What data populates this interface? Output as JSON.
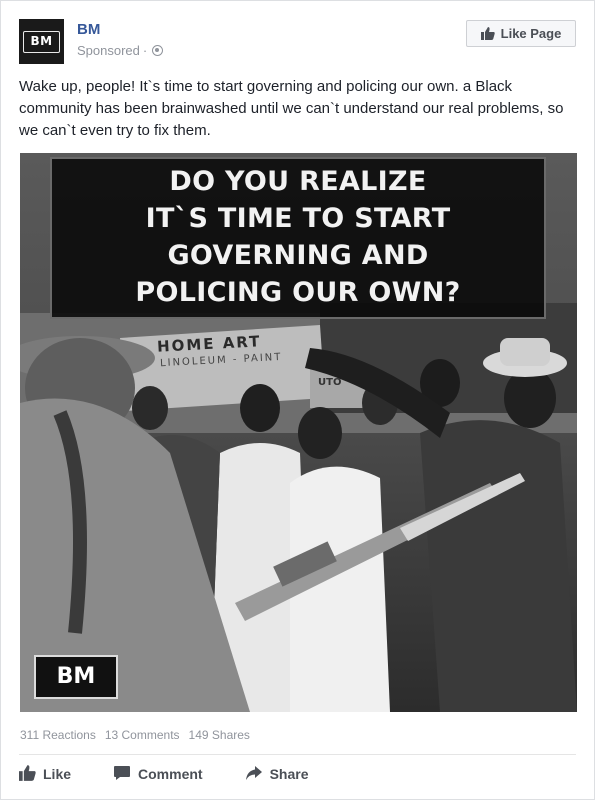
{
  "header": {
    "avatar_text": "BM",
    "page_name": "BM",
    "sponsored_label": "Sponsored",
    "separator": "·",
    "like_page_label": "Like Page"
  },
  "post": {
    "text": "Wake up, people! It`s time to start governing and policing our own. a Black community has been brainwashed until we can`t understand our real problems, so we can`t even try to fix them."
  },
  "image": {
    "headline_lines": [
      "DO YOU REALIZE",
      "IT`S TIME TO START",
      "GOVERNING AND",
      "POLICING OUR OWN?"
    ],
    "badge_text": "BM",
    "sign_text": "HOME ART",
    "sign_sub_text": "LINOLEUM - PAINT",
    "sign_fragment": "UTO"
  },
  "stats": {
    "reactions": "311 Reactions",
    "comments": "13 Comments",
    "shares": "149 Shares"
  },
  "actions": {
    "like_label": "Like",
    "comment_label": "Comment",
    "share_label": "Share"
  },
  "colors": {
    "link_blue": "#365899",
    "meta_gray": "#90949c",
    "action_gray": "#4b4f56",
    "text": "#1d2129"
  },
  "icons": [
    "globe-icon",
    "thumbs-up-icon",
    "comment-icon",
    "share-icon"
  ]
}
